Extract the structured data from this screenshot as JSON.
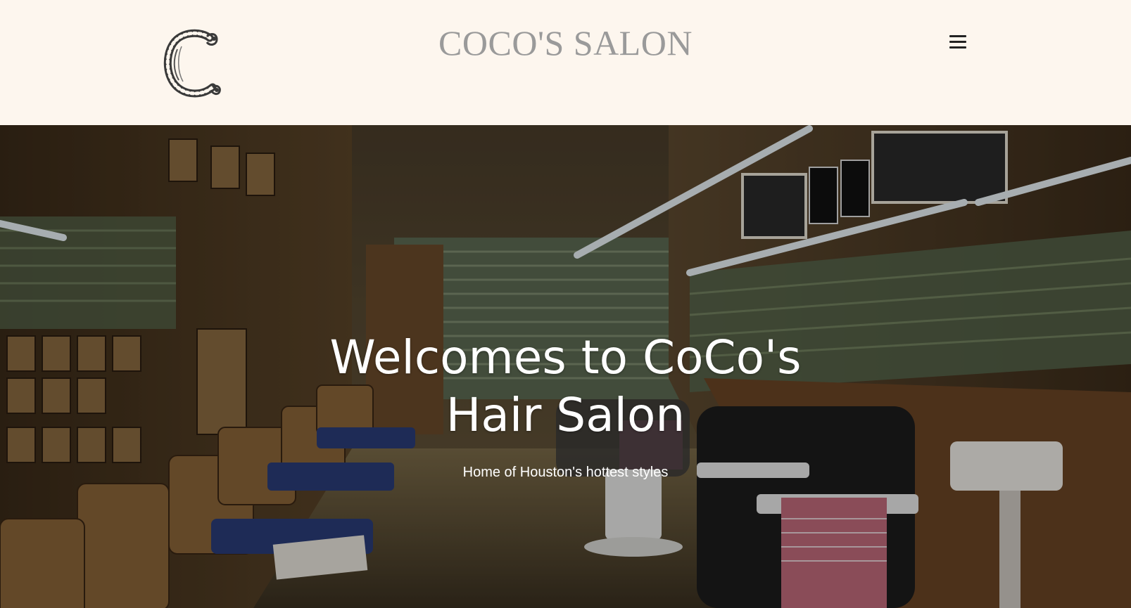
{
  "header": {
    "logo_letter": "C",
    "site_title": "COCO'S SALON",
    "menu_icon": "hamburger-menu-icon"
  },
  "hero": {
    "heading_line1": "Welcomes to CoCo's",
    "heading_line2": "Hair Salon",
    "subtitle": "Home of Houston's hottest styles",
    "background_image": "barbershop-interior-photo"
  },
  "colors": {
    "header_background": "#fdf6ee",
    "title_text": "#9a9a9a",
    "hero_text": "#ffffff"
  }
}
